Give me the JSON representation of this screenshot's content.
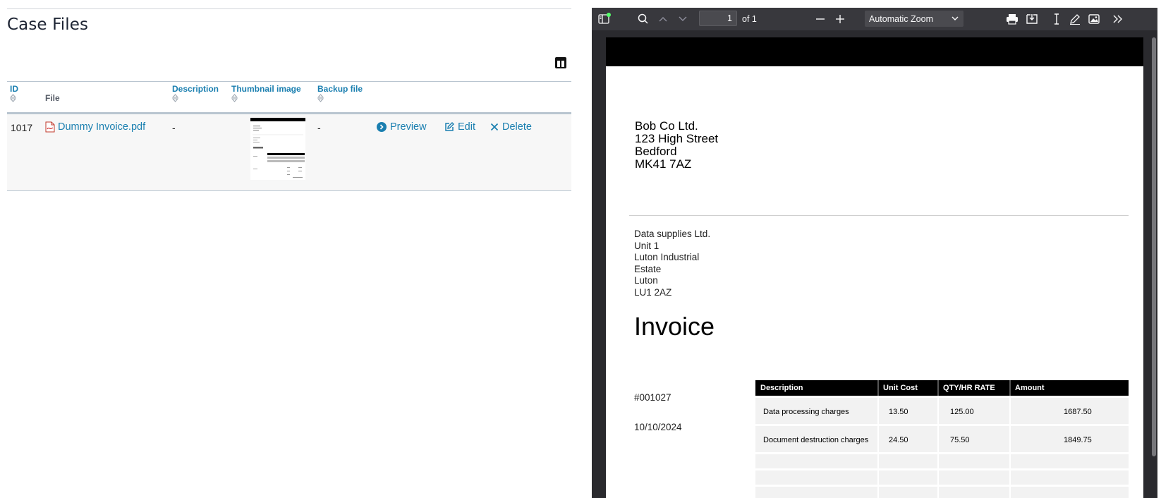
{
  "case_files": {
    "title": "Case Files",
    "columns": {
      "id": "ID",
      "file": "File",
      "description": "Description",
      "thumbnail": "Thumbnail image",
      "backup": "Backup file"
    },
    "rows": [
      {
        "id": "1017",
        "file": "Dummy Invoice.pdf",
        "description": "-",
        "backup": "-",
        "actions": {
          "preview": "Preview",
          "edit": "Edit",
          "delete": "Delete"
        }
      }
    ]
  },
  "viewer": {
    "page_number": "1",
    "page_count": "of 1",
    "zoom": "Automatic Zoom"
  },
  "pdf": {
    "sender": [
      "Bob Co Ltd.",
      "123 High Street",
      "Bedford",
      "MK41 7AZ"
    ],
    "recipient": [
      "Data supplies Ltd.",
      "Unit 1",
      "Luton Industrial",
      "Estate",
      "Luton",
      "LU1 2AZ"
    ],
    "heading": "Invoice",
    "number": "#001027",
    "date": "10/10/2024",
    "table": {
      "headers": [
        "Description",
        "Unit Cost",
        "QTY/HR RATE",
        "Amount"
      ],
      "rows": [
        [
          "Data processing charges",
          "13.50",
          "125.00",
          "1687.50"
        ],
        [
          "Document destruction charges",
          "24.50",
          "75.50",
          "1849.75"
        ]
      ]
    }
  },
  "colors": {
    "link": "#1a7fb0",
    "title": "#1d2433",
    "viewer_toolbar": "#38383d",
    "viewer_bg": "#2a2a2e"
  }
}
